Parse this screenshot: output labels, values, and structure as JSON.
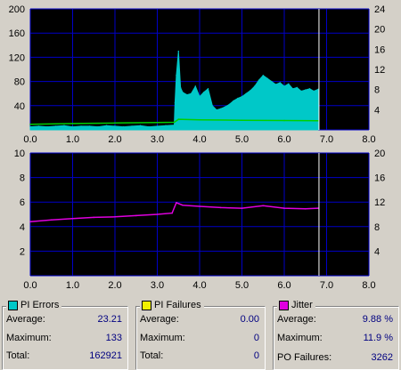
{
  "chart_data": [
    {
      "type": "area",
      "xlim": [
        0,
        8
      ],
      "ylim": [
        0,
        200
      ],
      "y2lim": [
        0,
        24
      ],
      "x_ticks": [
        "0.0",
        "1.0",
        "2.0",
        "3.0",
        "4.0",
        "5.0",
        "6.0",
        "7.0",
        "8.0"
      ],
      "y_ticks": [
        "40",
        "80",
        "120",
        "160",
        "200"
      ],
      "y2_ticks": [
        "4",
        "8",
        "12",
        "16",
        "20",
        "24"
      ],
      "grid": true,
      "marker_x": 6.82,
      "series": [
        {
          "color": "#00c8c8",
          "x": [
            0.0,
            0.2,
            0.4,
            0.6,
            0.8,
            1.0,
            1.2,
            1.4,
            1.6,
            1.8,
            2.0,
            2.2,
            2.4,
            2.6,
            2.8,
            3.0,
            3.2,
            3.4,
            3.42,
            3.45,
            3.5,
            3.55,
            3.6,
            3.7,
            3.8,
            3.9,
            4.0,
            4.1,
            4.2,
            4.3,
            4.4,
            4.5,
            4.6,
            4.7,
            4.8,
            4.9,
            5.0,
            5.1,
            5.2,
            5.3,
            5.4,
            5.5,
            5.6,
            5.7,
            5.8,
            5.9,
            6.0,
            6.1,
            6.2,
            6.3,
            6.4,
            6.5,
            6.6,
            6.7,
            6.8
          ],
          "values": [
            5,
            6,
            5,
            6,
            7,
            5,
            6,
            6,
            5,
            7,
            6,
            5,
            6,
            7,
            5,
            6,
            7,
            8,
            45,
            90,
            130,
            70,
            62,
            58,
            60,
            72,
            55,
            62,
            68,
            40,
            33,
            35,
            38,
            42,
            48,
            52,
            55,
            60,
            65,
            72,
            82,
            90,
            85,
            80,
            75,
            78,
            72,
            76,
            68,
            70,
            64,
            66,
            68,
            64,
            67
          ]
        },
        {
          "axis": "right",
          "color": "#00d000",
          "x": [
            0.0,
            1.0,
            2.0,
            3.0,
            3.4,
            3.5,
            4.0,
            5.0,
            6.0,
            6.8
          ],
          "values": [
            1.1,
            1.25,
            1.35,
            1.45,
            1.5,
            2.1,
            2.0,
            1.9,
            1.85,
            1.8
          ]
        }
      ]
    },
    {
      "type": "line",
      "xlim": [
        0,
        8
      ],
      "ylim": [
        0,
        10
      ],
      "y2lim": [
        0,
        20
      ],
      "x_ticks": [
        "0.0",
        "1.0",
        "2.0",
        "3.0",
        "4.0",
        "5.0",
        "6.0",
        "7.0",
        "8.0"
      ],
      "y_ticks": [
        "2",
        "4",
        "6",
        "8",
        "10"
      ],
      "y2_ticks": [
        "4",
        "8",
        "12",
        "16",
        "20"
      ],
      "grid": true,
      "marker_x": 6.82,
      "series": [
        {
          "color": "#e000e0",
          "x": [
            0.0,
            0.5,
            1.0,
            1.5,
            2.0,
            2.5,
            3.0,
            3.35,
            3.45,
            3.6,
            4.0,
            4.5,
            5.0,
            5.5,
            6.0,
            6.5,
            6.8
          ],
          "values": [
            4.4,
            4.55,
            4.65,
            4.75,
            4.8,
            4.9,
            5.0,
            5.1,
            5.95,
            5.75,
            5.65,
            5.55,
            5.5,
            5.7,
            5.5,
            5.45,
            5.5
          ]
        }
      ]
    }
  ],
  "stats": {
    "pi_errors": {
      "title": "PI Errors",
      "color": "#00c8c8",
      "average_label": "Average:",
      "average": "23.21",
      "maximum_label": "Maximum:",
      "maximum": "133",
      "total_label": "Total:",
      "total": "162921"
    },
    "pi_failures": {
      "title": "PI Failures",
      "color": "#f0f000",
      "average_label": "Average:",
      "average": "0.00",
      "maximum_label": "Maximum:",
      "maximum": "0",
      "total_label": "Total:",
      "total": "0"
    },
    "jitter": {
      "title": "Jitter",
      "color": "#e000e0",
      "average_label": "Average:",
      "average": "9.88 %",
      "maximum_label": "Maximum:",
      "maximum": "11.9 %",
      "po_failures_label": "PO Failures:",
      "po_failures": "3262"
    }
  }
}
